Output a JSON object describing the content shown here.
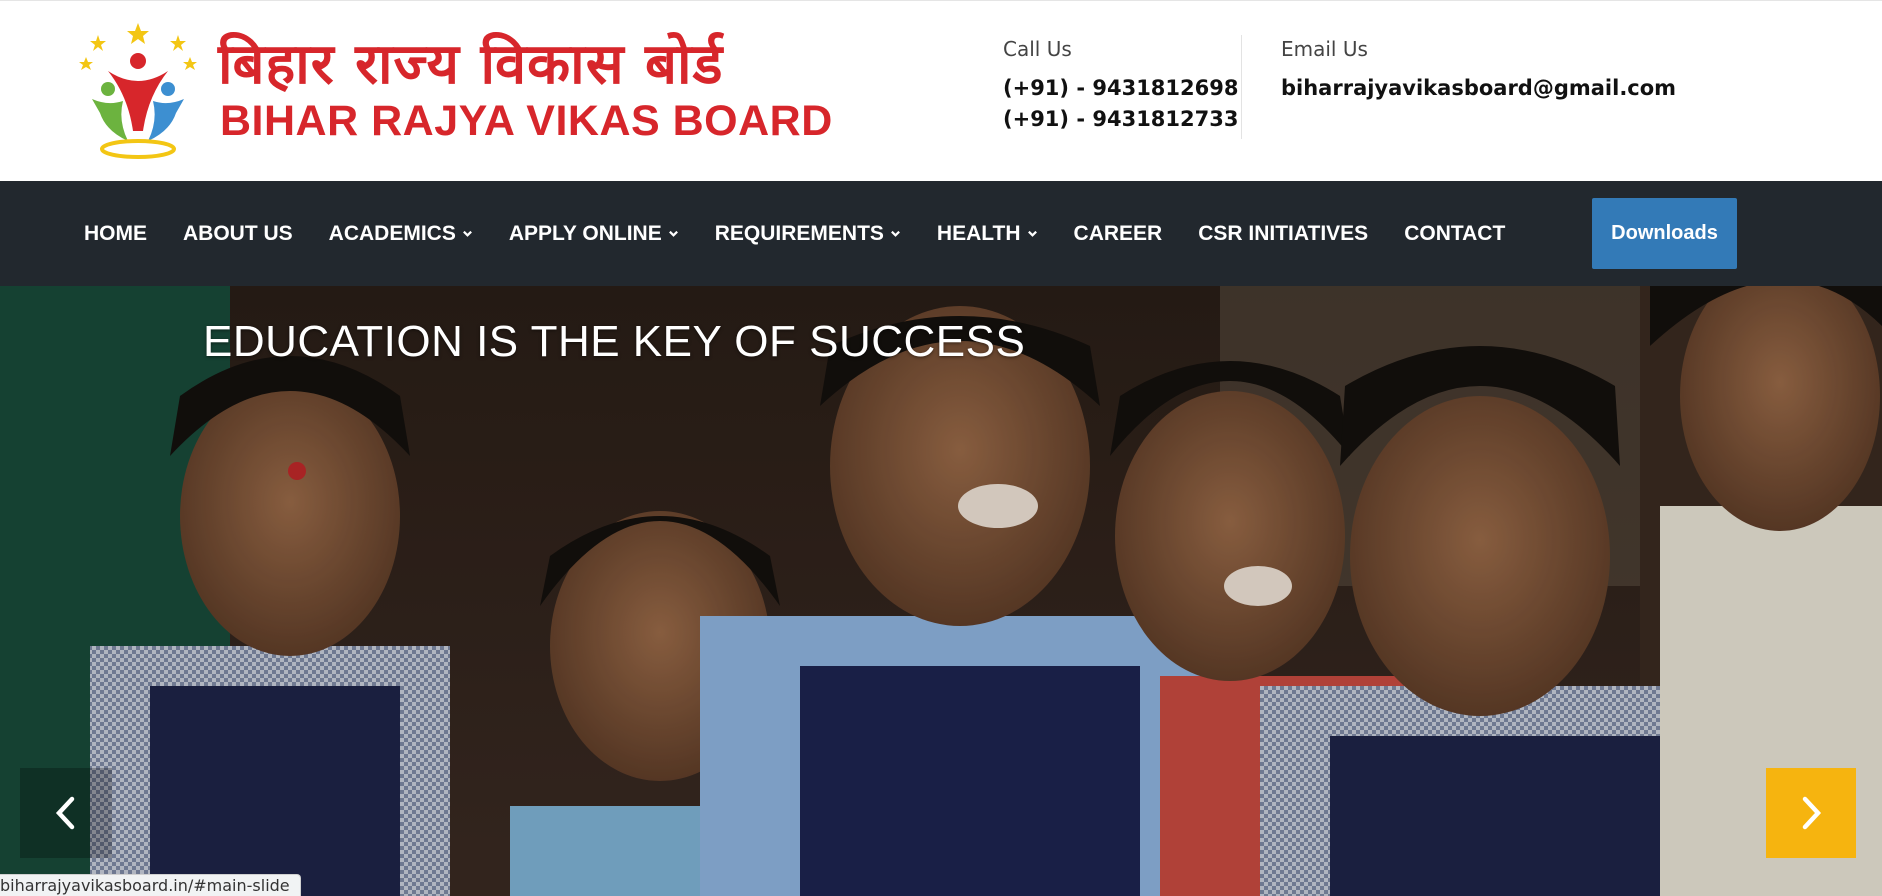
{
  "header": {
    "logo_hindi": "बिहार राज्य विकास बोर्ड",
    "logo_english": "BIHAR RAJYA VIKAS BOARD",
    "call_label": "Call Us",
    "phones": [
      "(+91) - 9431812698",
      "(+91) - 9431812733"
    ],
    "email_label": "Email Us",
    "email": "biharrajyavikasboard@gmail.com"
  },
  "nav": {
    "items": [
      {
        "label": "HOME",
        "dropdown": false
      },
      {
        "label": "ABOUT US",
        "dropdown": false
      },
      {
        "label": "ACADEMICS",
        "dropdown": true
      },
      {
        "label": "APPLY ONLINE",
        "dropdown": true
      },
      {
        "label": "REQUIREMENTS",
        "dropdown": true
      },
      {
        "label": "HEALTH",
        "dropdown": true
      },
      {
        "label": "CAREER",
        "dropdown": false
      },
      {
        "label": "CSR INITIATIVES",
        "dropdown": false
      },
      {
        "label": "CONTACT",
        "dropdown": false
      }
    ],
    "downloads_label": "Downloads"
  },
  "hero": {
    "title": "EDUCATION IS THE KEY OF SUCCESS",
    "prev_icon": "chevron-left-icon",
    "next_icon": "chevron-right-icon"
  },
  "status_bar": {
    "url": "biharrajyavikasboard.in/#main-slide"
  },
  "colors": {
    "brand_red": "#d7262b",
    "nav_bg": "#22282e",
    "downloads_bg": "#337ab7",
    "next_arrow_bg": "#f6b40f"
  }
}
